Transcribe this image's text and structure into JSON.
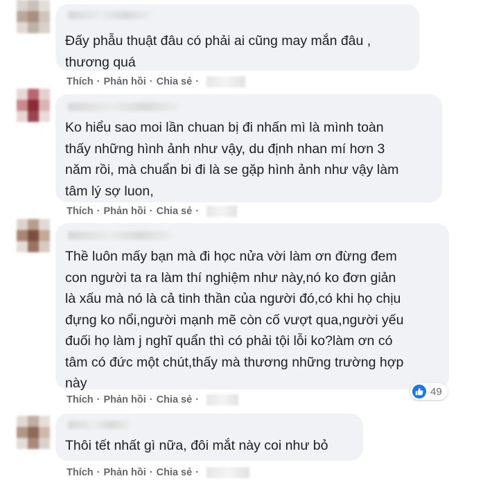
{
  "comments": [
    {
      "text": "Đấy phẫu thuật đâu có phải ai cũng may mắn đâu ,\nthương quá",
      "actions": [
        "Thích",
        "Phản hồi",
        "Chia sẻ"
      ]
    },
    {
      "text": "Ko hiểu sao moi lần chuan bị đi nhấn mì là mình toàn\nthấy những hình ảnh như vậy, du định nhan mí hơn 3\nnăm rồi, mà chuẩn bi đi là se gặp hình ảnh như vậy làm\ntâm lý sợ luon,",
      "actions": [
        "Thích",
        "Phản hồi",
        "Chia sẻ"
      ]
    },
    {
      "text": "Thề luôn mấy bạn mà đi học nửa vời làm ơn đừng đem\ncon người ta ra làm thí nghiệm như này,nó ko đơn giản\nlà xấu mà nó là cả tinh thần của người đó,có khi họ chịu\nđựng ko nổi,người mạnh mẽ còn cố vượt qua,người yếu\nđuối họ làm j nghĩ quẩn thì có phải tội lỗi ko?làm ơn có\ntâm có đức một chút,thấy mà thương những trường hợp\nnày",
      "actions": [
        "Thích",
        "Phản hồi",
        "Chia sẻ"
      ],
      "reaction_count": "49"
    },
    {
      "text": "Thôi tết nhất gì nữa, đôi mắt này coi như bỏ",
      "actions": [
        "Thích",
        "Phản hồi",
        "Chia sẻ"
      ]
    }
  ],
  "icons": {
    "reaction": "like-icon"
  },
  "colors": {
    "bubble": "#f0f2f5",
    "action_text": "#65676b",
    "like_blue": "#1877f2"
  }
}
